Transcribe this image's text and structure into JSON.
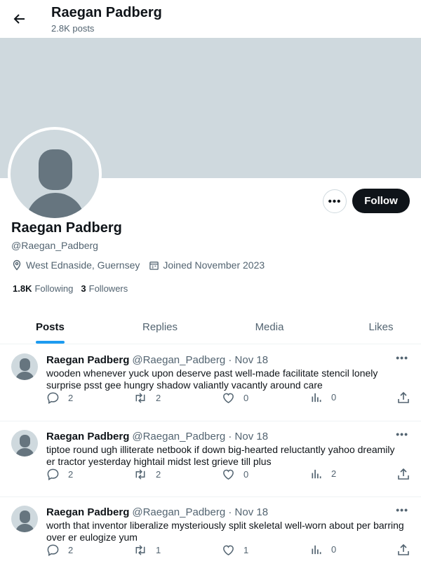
{
  "header": {
    "title": "Raegan Padberg",
    "post_count": "2.8K posts"
  },
  "profile": {
    "name": "Raegan Padberg",
    "handle": "@Raegan_Padberg",
    "location": "West Ednaside, Guernsey",
    "joined": "Joined November 2023",
    "following_count": "1.8K",
    "following_label": "Following",
    "followers_count": "3",
    "followers_label": "Followers",
    "follow_button": "Follow",
    "more_button": "•••"
  },
  "tabs": [
    {
      "label": "Posts",
      "active": true
    },
    {
      "label": "Replies",
      "active": false
    },
    {
      "label": "Media",
      "active": false
    },
    {
      "label": "Likes",
      "active": false
    }
  ],
  "posts": [
    {
      "name": "Raegan Padberg",
      "handle": "@Raegan_Padberg · Nov 18",
      "text": "wooden whenever yuck upon deserve past well-made facilitate stencil lonely surprise psst gee hungry shadow valiantly vacantly around care",
      "replies": "2",
      "reposts": "2",
      "likes": "0",
      "views": "0"
    },
    {
      "name": "Raegan Padberg",
      "handle": "@Raegan_Padberg · Nov 18",
      "text": "tiptoe round ugh illiterate netbook if down big-hearted reluctantly yahoo dreamily er tractor yesterday hightail midst lest grieve till plus",
      "replies": "2",
      "reposts": "2",
      "likes": "0",
      "views": "2"
    },
    {
      "name": "Raegan Padberg",
      "handle": "@Raegan_Padberg · Nov 18",
      "text": "worth that inventor liberalize mysteriously split skeletal well-worn about per barring over er eulogize yum",
      "replies": "2",
      "reposts": "1",
      "likes": "1",
      "views": "0"
    }
  ],
  "colors": {
    "accent": "#1d9bf0",
    "banner": "#cfd9de",
    "text": "#0f1419",
    "muted": "#536471"
  }
}
